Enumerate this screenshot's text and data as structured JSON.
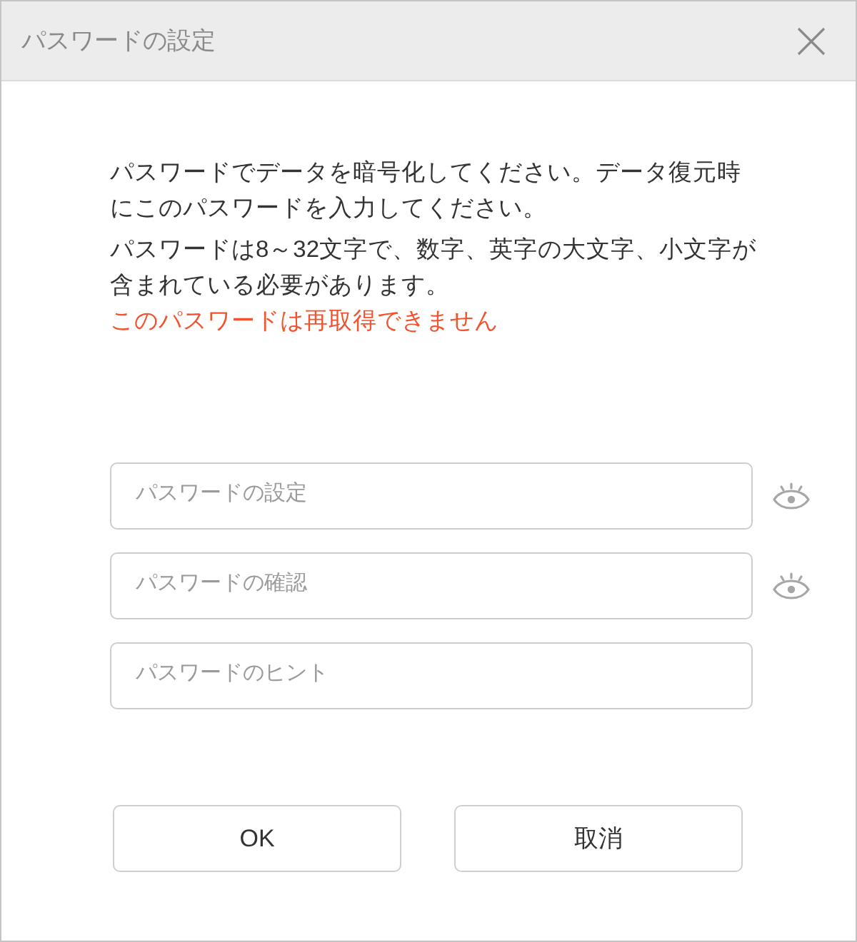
{
  "window": {
    "title": "パスワードの設定"
  },
  "message": {
    "paragraphs": [
      "パスワードでデータを暗号化してください。データ復元時にこのパスワードを入力してください。",
      "パスワードは8～32文字で、数字、英字の大文字、小文字が含まれている必要があります。"
    ],
    "warning": "このパスワードは再取得できません"
  },
  "fields": [
    {
      "placeholder": "パスワードの設定",
      "reveal_toggle": true
    },
    {
      "placeholder": "パスワードの確認",
      "reveal_toggle": true
    },
    {
      "placeholder": "パスワードのヒント",
      "reveal_toggle": false
    }
  ],
  "buttons": [
    "OK",
    "取消"
  ]
}
